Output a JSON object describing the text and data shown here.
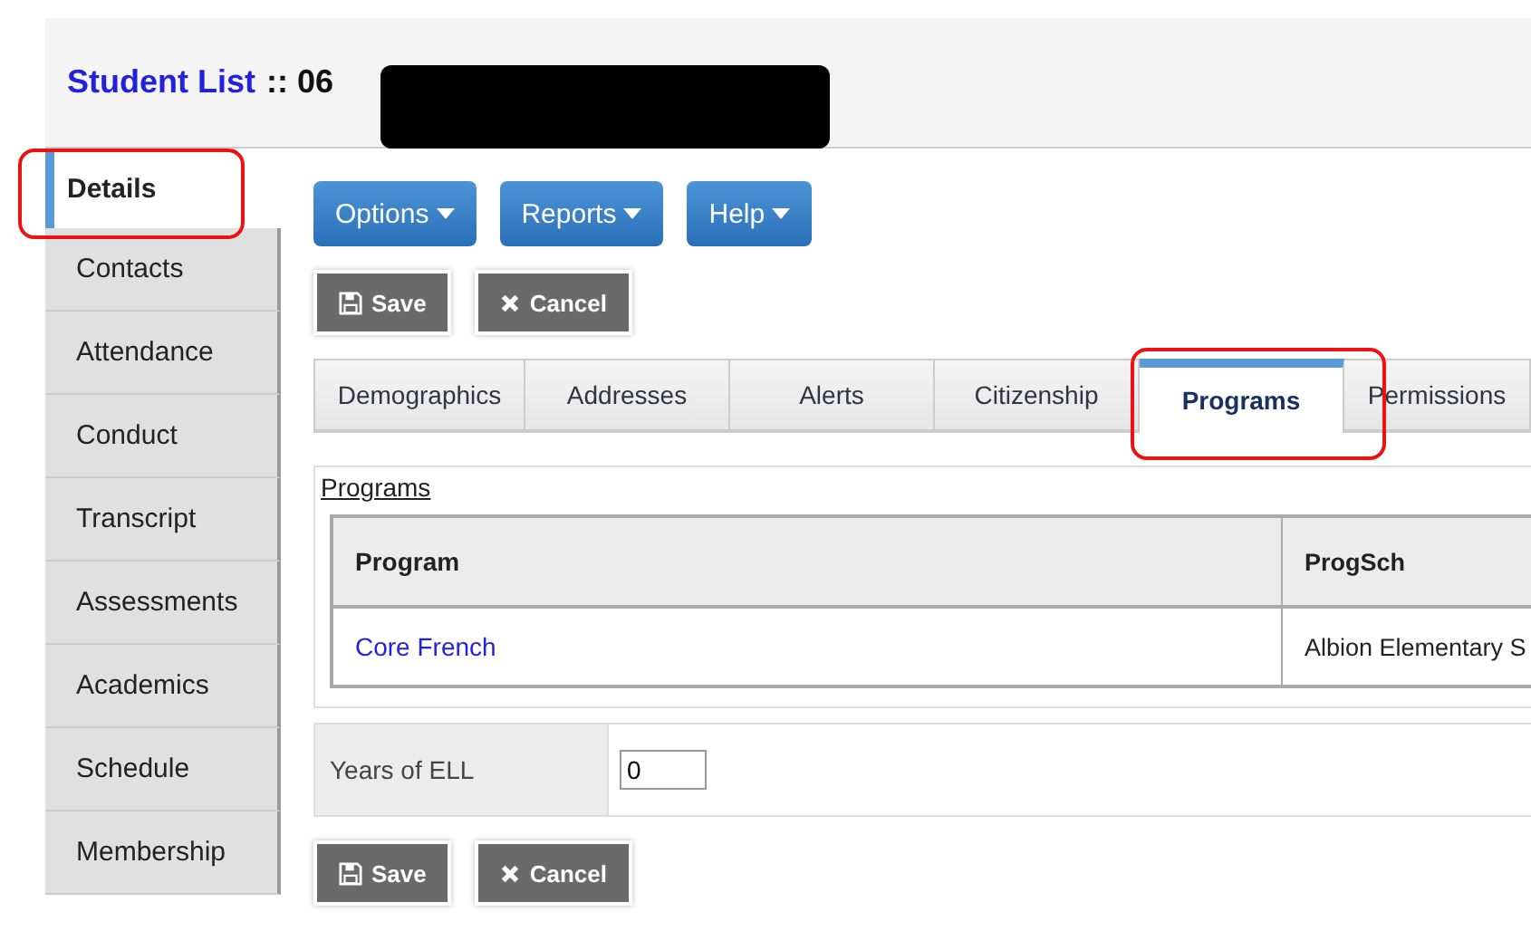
{
  "header": {
    "title": "Student List",
    "suffix": ":: 06",
    "redacted": true
  },
  "sidebar": {
    "items": [
      {
        "label": "Details",
        "selected": true,
        "highlighted": true
      },
      {
        "label": "Contacts",
        "selected": false,
        "highlighted": false
      },
      {
        "label": "Attendance",
        "selected": false,
        "highlighted": false
      },
      {
        "label": "Conduct",
        "selected": false,
        "highlighted": false
      },
      {
        "label": "Transcript",
        "selected": false,
        "highlighted": false
      },
      {
        "label": "Assessments",
        "selected": false,
        "highlighted": false
      },
      {
        "label": "Academics",
        "selected": false,
        "highlighted": false
      },
      {
        "label": "Schedule",
        "selected": false,
        "highlighted": false
      },
      {
        "label": "Membership",
        "selected": false,
        "highlighted": false
      }
    ]
  },
  "menu_buttons": [
    "Options",
    "Reports",
    "Help"
  ],
  "top_actions": {
    "save": "Save",
    "cancel": "Cancel"
  },
  "tabs": [
    {
      "label": "Demographics",
      "selected": false,
      "highlighted": false
    },
    {
      "label": "Addresses",
      "selected": false,
      "highlighted": false
    },
    {
      "label": "Alerts",
      "selected": false,
      "highlighted": false
    },
    {
      "label": "Citizenship",
      "selected": false,
      "highlighted": false
    },
    {
      "label": "Programs",
      "selected": true,
      "highlighted": true
    },
    {
      "label": "Permissions",
      "selected": false,
      "highlighted": false
    }
  ],
  "programs": {
    "link": "Programs",
    "columns": [
      "Program",
      "ProgSch"
    ],
    "rows": [
      [
        "Core French",
        "Albion Elementary S"
      ]
    ]
  },
  "field": {
    "label": "Years of ELL",
    "value": "0"
  },
  "bottom_actions": {
    "save": "Save",
    "cancel": "Cancel"
  }
}
